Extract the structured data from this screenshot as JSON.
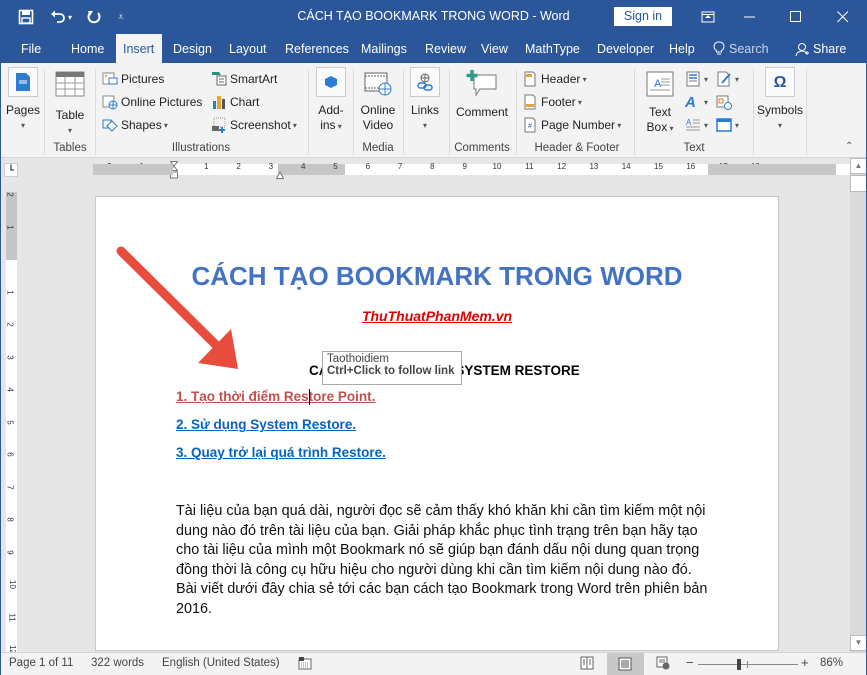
{
  "titlebar": {
    "title": "CÁCH TẠO BOOKMARK TRONG WORD  -  Word",
    "signin_label": "Sign in",
    "qat": [
      "save-icon",
      "undo-icon",
      "redo-icon",
      "customize-qat-icon"
    ],
    "window_buttons": [
      "ribbon-display-options-icon",
      "minimize-icon",
      "maximize-icon",
      "close-icon"
    ]
  },
  "tabs": [
    {
      "label": "File"
    },
    {
      "label": "Home"
    },
    {
      "label": "Insert",
      "active": true
    },
    {
      "label": "Design"
    },
    {
      "label": "Layout"
    },
    {
      "label": "References"
    },
    {
      "label": "Mailings"
    },
    {
      "label": "Review"
    },
    {
      "label": "View"
    },
    {
      "label": "MathType"
    },
    {
      "label": "Developer"
    },
    {
      "label": "Help"
    }
  ],
  "search_label": "Search",
  "share_label": "Share",
  "ribbon": {
    "groups": {
      "pages": {
        "label": "",
        "button": "Pages"
      },
      "tables": {
        "label": "Tables",
        "button": "Table"
      },
      "illustrations": {
        "label": "Illustrations",
        "items": [
          "Pictures",
          "Online Pictures",
          "Shapes",
          "SmartArt",
          "Chart",
          "Screenshot"
        ]
      },
      "addins": {
        "label": "",
        "button_line1": "Add-",
        "button_line2": "ins"
      },
      "media": {
        "label": "Media",
        "button_line1": "Online",
        "button_line2": "Video"
      },
      "links": {
        "label": "",
        "button": "Links"
      },
      "comments": {
        "label": "Comments",
        "button": "Comment"
      },
      "header_footer": {
        "label": "Header & Footer",
        "items": [
          "Header",
          "Footer",
          "Page Number"
        ]
      },
      "text": {
        "label": "Text",
        "button_line1": "Text",
        "button_line2": "Box"
      },
      "symbols": {
        "label": "",
        "button": "Symbols"
      }
    }
  },
  "ruler": {
    "horizontal_labels": [
      "2",
      "1",
      "1",
      "2",
      "3",
      "4",
      "5",
      "6",
      "7",
      "8",
      "9",
      "10",
      "11",
      "12",
      "13",
      "14",
      "15",
      "16",
      "17",
      "18"
    ],
    "vertical_labels": [
      "2",
      "1",
      "1",
      "2",
      "3",
      "4",
      "5",
      "6",
      "7",
      "8",
      "9",
      "10",
      "11",
      "12"
    ]
  },
  "document": {
    "title": "CÁCH TẠO BOOKMARK TRONG WORD",
    "site": "ThuThuatPhanMem.vn",
    "section_heading": "CÁC BƯỚC SỬ DỤNG SYSTEM RESTORE",
    "links": [
      {
        "text": "1. Tạo thời điểm Restore Point.",
        "color": "#c0504d",
        "visited": true
      },
      {
        "text": "2. Sử dụng System Restore.",
        "color": "#0563c1"
      },
      {
        "text": "3. Quay trở lại quá trình Restore.",
        "color": "#0563c1"
      }
    ],
    "paragraph": "Tài liệu của bạn quá dài, người đọc sẽ cảm thấy khó khăn khi cần tìm kiếm một nội dung nào đó trên tài liệu của bạn. Giải pháp khắc phục tình trạng trên bạn hãy tạo cho tài liệu của mình một Bookmark nó sẽ giúp bạn đánh dấu nội dung quan trọng đồng thời là công cụ hữu hiệu cho người dùng khi cần tìm kiếm nội dung nào đó. Bài viết dưới đây chia sẻ tới các bạn cách tạo Bookmark trong Word trên phiên bản 2016."
  },
  "tooltip": {
    "bookmark": "Taothoidiem",
    "hint": "Ctrl+Click to follow link"
  },
  "annotation_arrow": {
    "color": "#e84c3d",
    "direction": "down-right"
  },
  "statusbar": {
    "page": "Page 1 of 11",
    "words": "322 words",
    "language": "English (United States)",
    "zoom": "86%",
    "zoom_level_percent": 86,
    "views": [
      "read-mode",
      "print-layout",
      "web-layout"
    ],
    "active_view": "print-layout"
  },
  "colors": {
    "brand": "#2b579a",
    "title_blue": "#4472c4",
    "link_blue": "#0563c1",
    "visited_link": "#c0504d",
    "site_red": "#e00000"
  }
}
